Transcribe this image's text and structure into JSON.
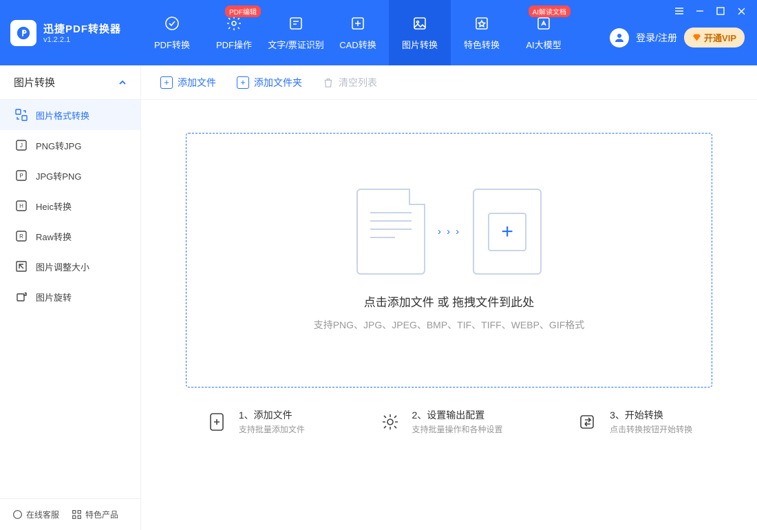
{
  "app": {
    "title": "迅捷PDF转换器",
    "version": "v1.2.2.1"
  },
  "nav": [
    {
      "label": "PDF转换"
    },
    {
      "label": "PDF操作",
      "badge": "PDF编辑"
    },
    {
      "label": "文字/票证识别"
    },
    {
      "label": "CAD转换"
    },
    {
      "label": "图片转换"
    },
    {
      "label": "特色转换"
    },
    {
      "label": "AI大模型",
      "badge": "AI解读文档"
    }
  ],
  "account": {
    "login": "登录/注册",
    "vip": "开通VIP"
  },
  "sidebar": {
    "header": "图片转换",
    "items": [
      {
        "label": "图片格式转换"
      },
      {
        "label": "PNG转JPG"
      },
      {
        "label": "JPG转PNG"
      },
      {
        "label": "Heic转换"
      },
      {
        "label": "Raw转换"
      },
      {
        "label": "图片调整大小"
      },
      {
        "label": "图片旋转"
      }
    ],
    "footer": {
      "service": "在线客服",
      "featured": "特色产品"
    }
  },
  "toolbar": {
    "add_file": "添加文件",
    "add_folder": "添加文件夹",
    "clear": "清空列表"
  },
  "drop": {
    "title": "点击添加文件 或 拖拽文件到此处",
    "sub": "支持PNG、JPG、JPEG、BMP、TIF、TIFF、WEBP、GIF格式"
  },
  "steps": [
    {
      "title": "1、添加文件",
      "sub": "支持批量添加文件"
    },
    {
      "title": "2、设置输出配置",
      "sub": "支持批量操作和各种设置"
    },
    {
      "title": "3、开始转换",
      "sub": "点击转换按钮开始转换"
    }
  ]
}
